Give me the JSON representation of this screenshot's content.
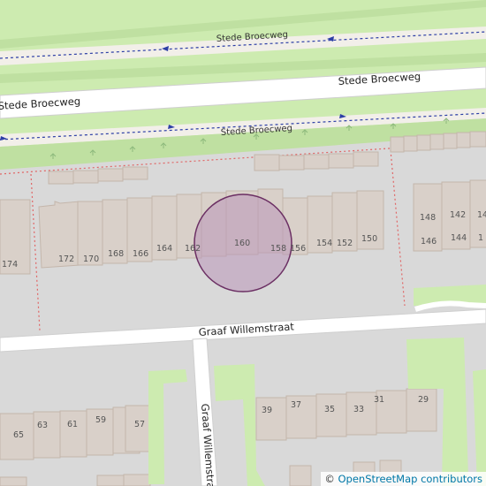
{
  "map": {
    "streets": {
      "top_path": "Stede Broecweg",
      "main_road": "Stede Broecweg",
      "lower_path": "Stede Broecweg",
      "cross_street": "Graaf Willemstraat",
      "side_street": "Graaf Willemstraat"
    },
    "house_numbers_north": [
      "172",
      "170",
      "168",
      "166",
      "164",
      "162",
      "160",
      "158",
      "156",
      "154",
      "152",
      "150"
    ],
    "house_numbers_west": "174",
    "house_numbers_east": [
      "148",
      "142",
      "146",
      "144",
      "14",
      "1"
    ],
    "house_numbers_south": [
      "65",
      "63",
      "61",
      "59",
      "57",
      "39",
      "37",
      "35",
      "33",
      "31",
      "29"
    ],
    "marker": {
      "type": "circle",
      "fill": "#b995b8",
      "stroke": "#6b2f63"
    },
    "colors": {
      "background": "#d9d9d9",
      "grass": "#cdebb0",
      "road": "#ffffff",
      "building": "#d9d0c9",
      "building_outline": "#c4b6ab",
      "path_blue": "#2d3fa6",
      "boundary_red": "#e06666"
    }
  },
  "attribution": {
    "copyright": "©",
    "link_text": "OpenStreetMap contributors"
  }
}
